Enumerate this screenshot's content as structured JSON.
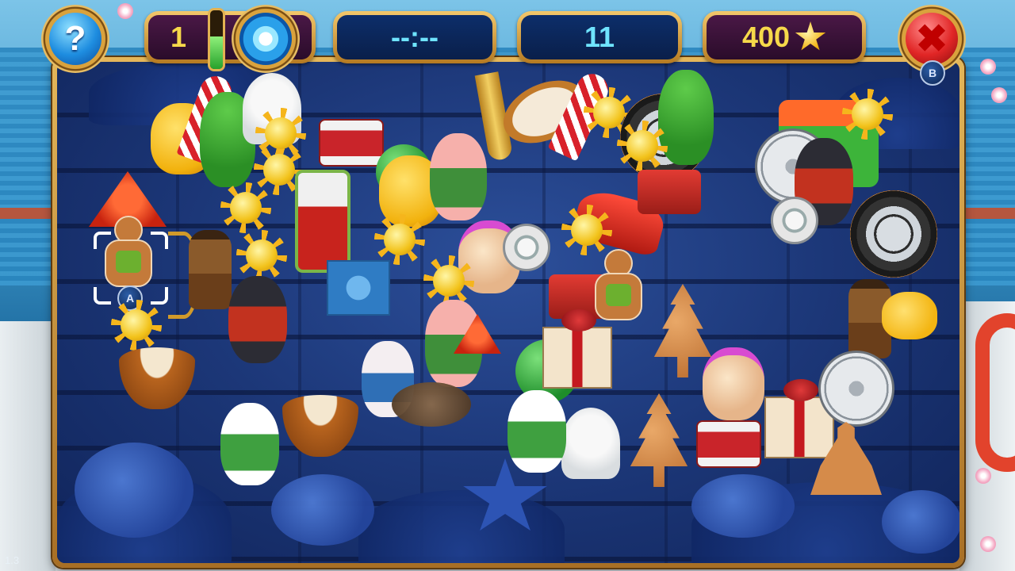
{
  "hud": {
    "hints_count": "1",
    "hint_charge": 0.55,
    "timer": "--:--",
    "items_remaining": "11",
    "score": "400",
    "help_label": "?",
    "close_label": "✖",
    "close_gamepad_hint": "B"
  },
  "board": {
    "select_gamepad_hint": "A"
  },
  "icons": {
    "help": "question-mark-icon",
    "hint": "sun-burst-icon",
    "close": "red-x-icon",
    "score": "gold-star-icon"
  },
  "colors": {
    "frame_gold": "#d9a23d",
    "panel_purple": "#2a0c2a",
    "panel_blue": "#0a1f4a",
    "timer_text": "#6fe4ff",
    "score_text": "#f6d94a"
  },
  "version": "1.3"
}
